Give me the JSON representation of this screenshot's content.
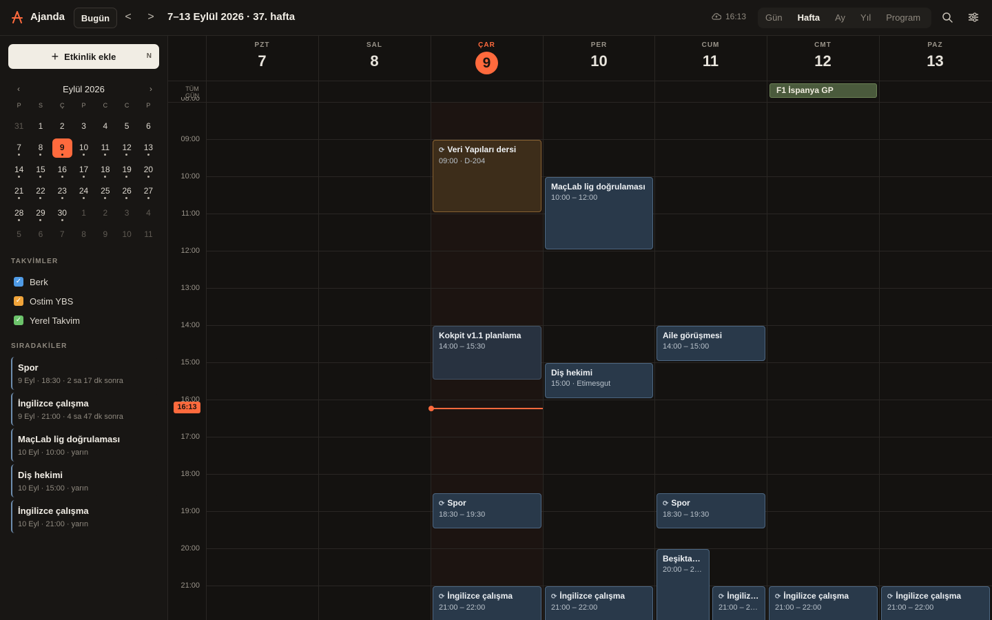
{
  "app": {
    "title": "Ajanda"
  },
  "toolbar": {
    "today_label": "Bugün",
    "prev_label": "<",
    "next_label": ">",
    "range_title": "7–13 Eylül 2026 · 37. hafta",
    "sync_time": "16:13",
    "views": [
      "Gün",
      "Hafta",
      "Ay",
      "Yıl",
      "Program"
    ],
    "active_view": "Hafta"
  },
  "sidebar": {
    "add_event_label": "Etkinlik ekle",
    "add_event_shortcut": "N",
    "mini_calendar": {
      "title": "Eylül 2026",
      "prev_label": "‹",
      "next_label": "›",
      "weekdays": [
        "P",
        "S",
        "Ç",
        "P",
        "C",
        "C",
        "P"
      ],
      "weeks": [
        [
          "31",
          "1",
          "2",
          "3",
          "4",
          "5",
          "6"
        ],
        [
          "7",
          "8",
          "9",
          "10",
          "11",
          "12",
          "13"
        ],
        [
          "14",
          "15",
          "16",
          "17",
          "18",
          "19",
          "20"
        ],
        [
          "21",
          "22",
          "23",
          "24",
          "25",
          "26",
          "27"
        ],
        [
          "28",
          "29",
          "30",
          "1",
          "2",
          "3",
          "4"
        ],
        [
          "5",
          "6",
          "7",
          "8",
          "9",
          "10",
          "11"
        ]
      ]
    },
    "calendars_label": "TAKVİMLER",
    "calendars": [
      {
        "name": "Berk",
        "color": "#4f9be6"
      },
      {
        "name": "Ostim YBS",
        "color": "#f0a43a"
      },
      {
        "name": "Yerel Takvim",
        "color": "#6cc36b"
      }
    ],
    "upcoming_label": "SIRADAKİLER",
    "upcoming": [
      {
        "title": "Spor",
        "date": "9 Eyl · 18:30",
        "relative": "2 sa 17 dk sonra"
      },
      {
        "title": "İngilizce çalışma",
        "date": "9 Eyl · 21:00",
        "relative": "4 sa 47 dk sonra"
      },
      {
        "title": "MaçLab lig doğrulaması",
        "date": "10 Eyl · 10:00",
        "relative": "yarın"
      },
      {
        "title": "Diş hekimi",
        "date": "10 Eyl · 15:00",
        "relative": "yarın"
      },
      {
        "title": "İngilizce çalışma",
        "date": "10 Eyl · 21:00",
        "relative": "yarın"
      }
    ]
  },
  "week": {
    "days": [
      {
        "name": "PZT",
        "num": "7"
      },
      {
        "name": "SAL",
        "num": "8"
      },
      {
        "name": "ÇAR",
        "num": "9"
      },
      {
        "name": "PER",
        "num": "10"
      },
      {
        "name": "CUM",
        "num": "11"
      },
      {
        "name": "CMT",
        "num": "12"
      },
      {
        "name": "PAZ",
        "num": "13"
      }
    ],
    "allday_label": "TÜM GÜN",
    "allday_events": [
      {
        "title": "F1 İspanya GP",
        "day": "CMT"
      }
    ],
    "hours": [
      "08:00",
      "09:00",
      "10:00",
      "11:00",
      "12:00",
      "13:00",
      "14:00",
      "15:00",
      "16:00",
      "17:00",
      "18:00",
      "19:00",
      "20:00",
      "21:00"
    ],
    "now_label": "16:13",
    "events": [
      {
        "title": "Veri Yapıları dersi",
        "time": "09:00 · D-204",
        "recurring": true
      },
      {
        "title": "MaçLab lig doğrulaması",
        "time": "10:00 – 12:00",
        "recurring": false
      },
      {
        "title": "Kokpit v1.1 planlama",
        "time": "14:00 – 15:30",
        "recurring": false
      },
      {
        "title": "Aile görüşmesi",
        "time": "14:00 – 15:00",
        "recurring": false
      },
      {
        "title": "Diş hekimi",
        "time": "15:00 · Etimesgut",
        "recurring": false
      },
      {
        "title": "Spor",
        "time": "18:30 – 19:30",
        "recurring": true
      },
      {
        "title": "Spor",
        "time": "18:30 – 19:30",
        "recurring": true
      },
      {
        "title": "Beşiktaş…",
        "time": "20:00 – 2…",
        "recurring": false
      },
      {
        "title": "İngilizce çalışma",
        "time": "21:00 – 22:00",
        "recurring": true
      },
      {
        "title": "İngilizce çalışma",
        "time": "21:00 – 22:00",
        "recurring": true
      },
      {
        "title": "İngiliz…",
        "time": "21:00 – 2…",
        "recurring": true
      },
      {
        "title": "İngilizce çalışma",
        "time": "21:00 – 22:00",
        "recurring": true
      },
      {
        "title": "İngilizce çalışma",
        "time": "21:00 – 22:00",
        "recurring": true
      }
    ]
  }
}
